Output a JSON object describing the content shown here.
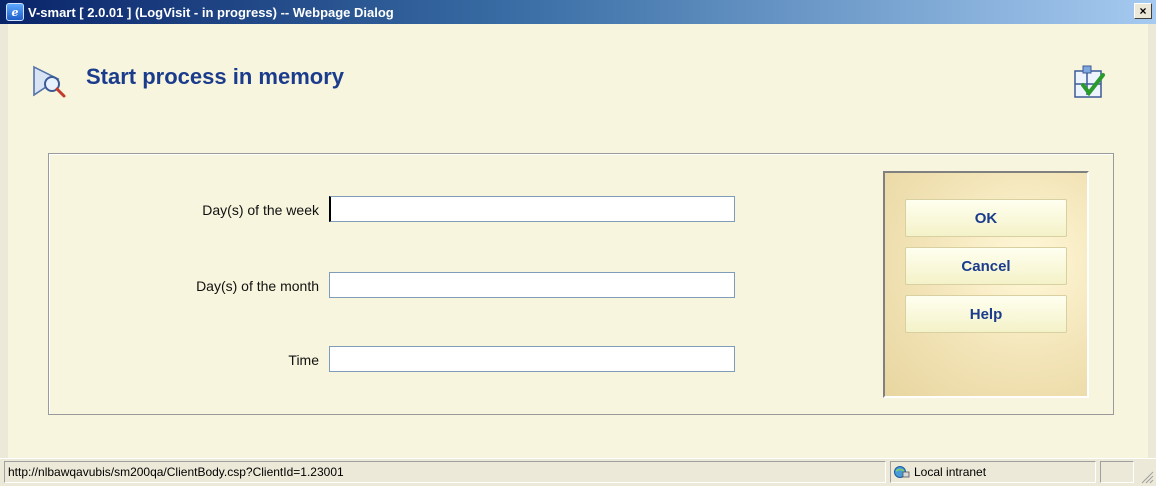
{
  "window": {
    "title": "V-smart [ 2.0.01 ] (LogVisit - in progress) -- Webpage Dialog",
    "app_icon_glyph": "e",
    "close_glyph": "×"
  },
  "page": {
    "title": "Start process in memory"
  },
  "form": {
    "fields": [
      {
        "label": "Day(s) of the week",
        "value": ""
      },
      {
        "label": "Day(s) of the month",
        "value": ""
      },
      {
        "label": "Time",
        "value": ""
      }
    ]
  },
  "buttons": {
    "ok": "OK",
    "cancel": "Cancel",
    "help": "Help"
  },
  "status": {
    "url": "http://nlbawqavubis/sm200qa/ClientBody.csp?ClientId=1.23001",
    "zone": "Local intranet"
  },
  "colors": {
    "title_text": "#1b3c8c",
    "content_bg": "#f7f5dd",
    "button_text": "#1b3c8c"
  },
  "icons": {
    "header": "search-document-icon",
    "workflow": "workflow-check-icon",
    "zone": "local-intranet-icon"
  }
}
